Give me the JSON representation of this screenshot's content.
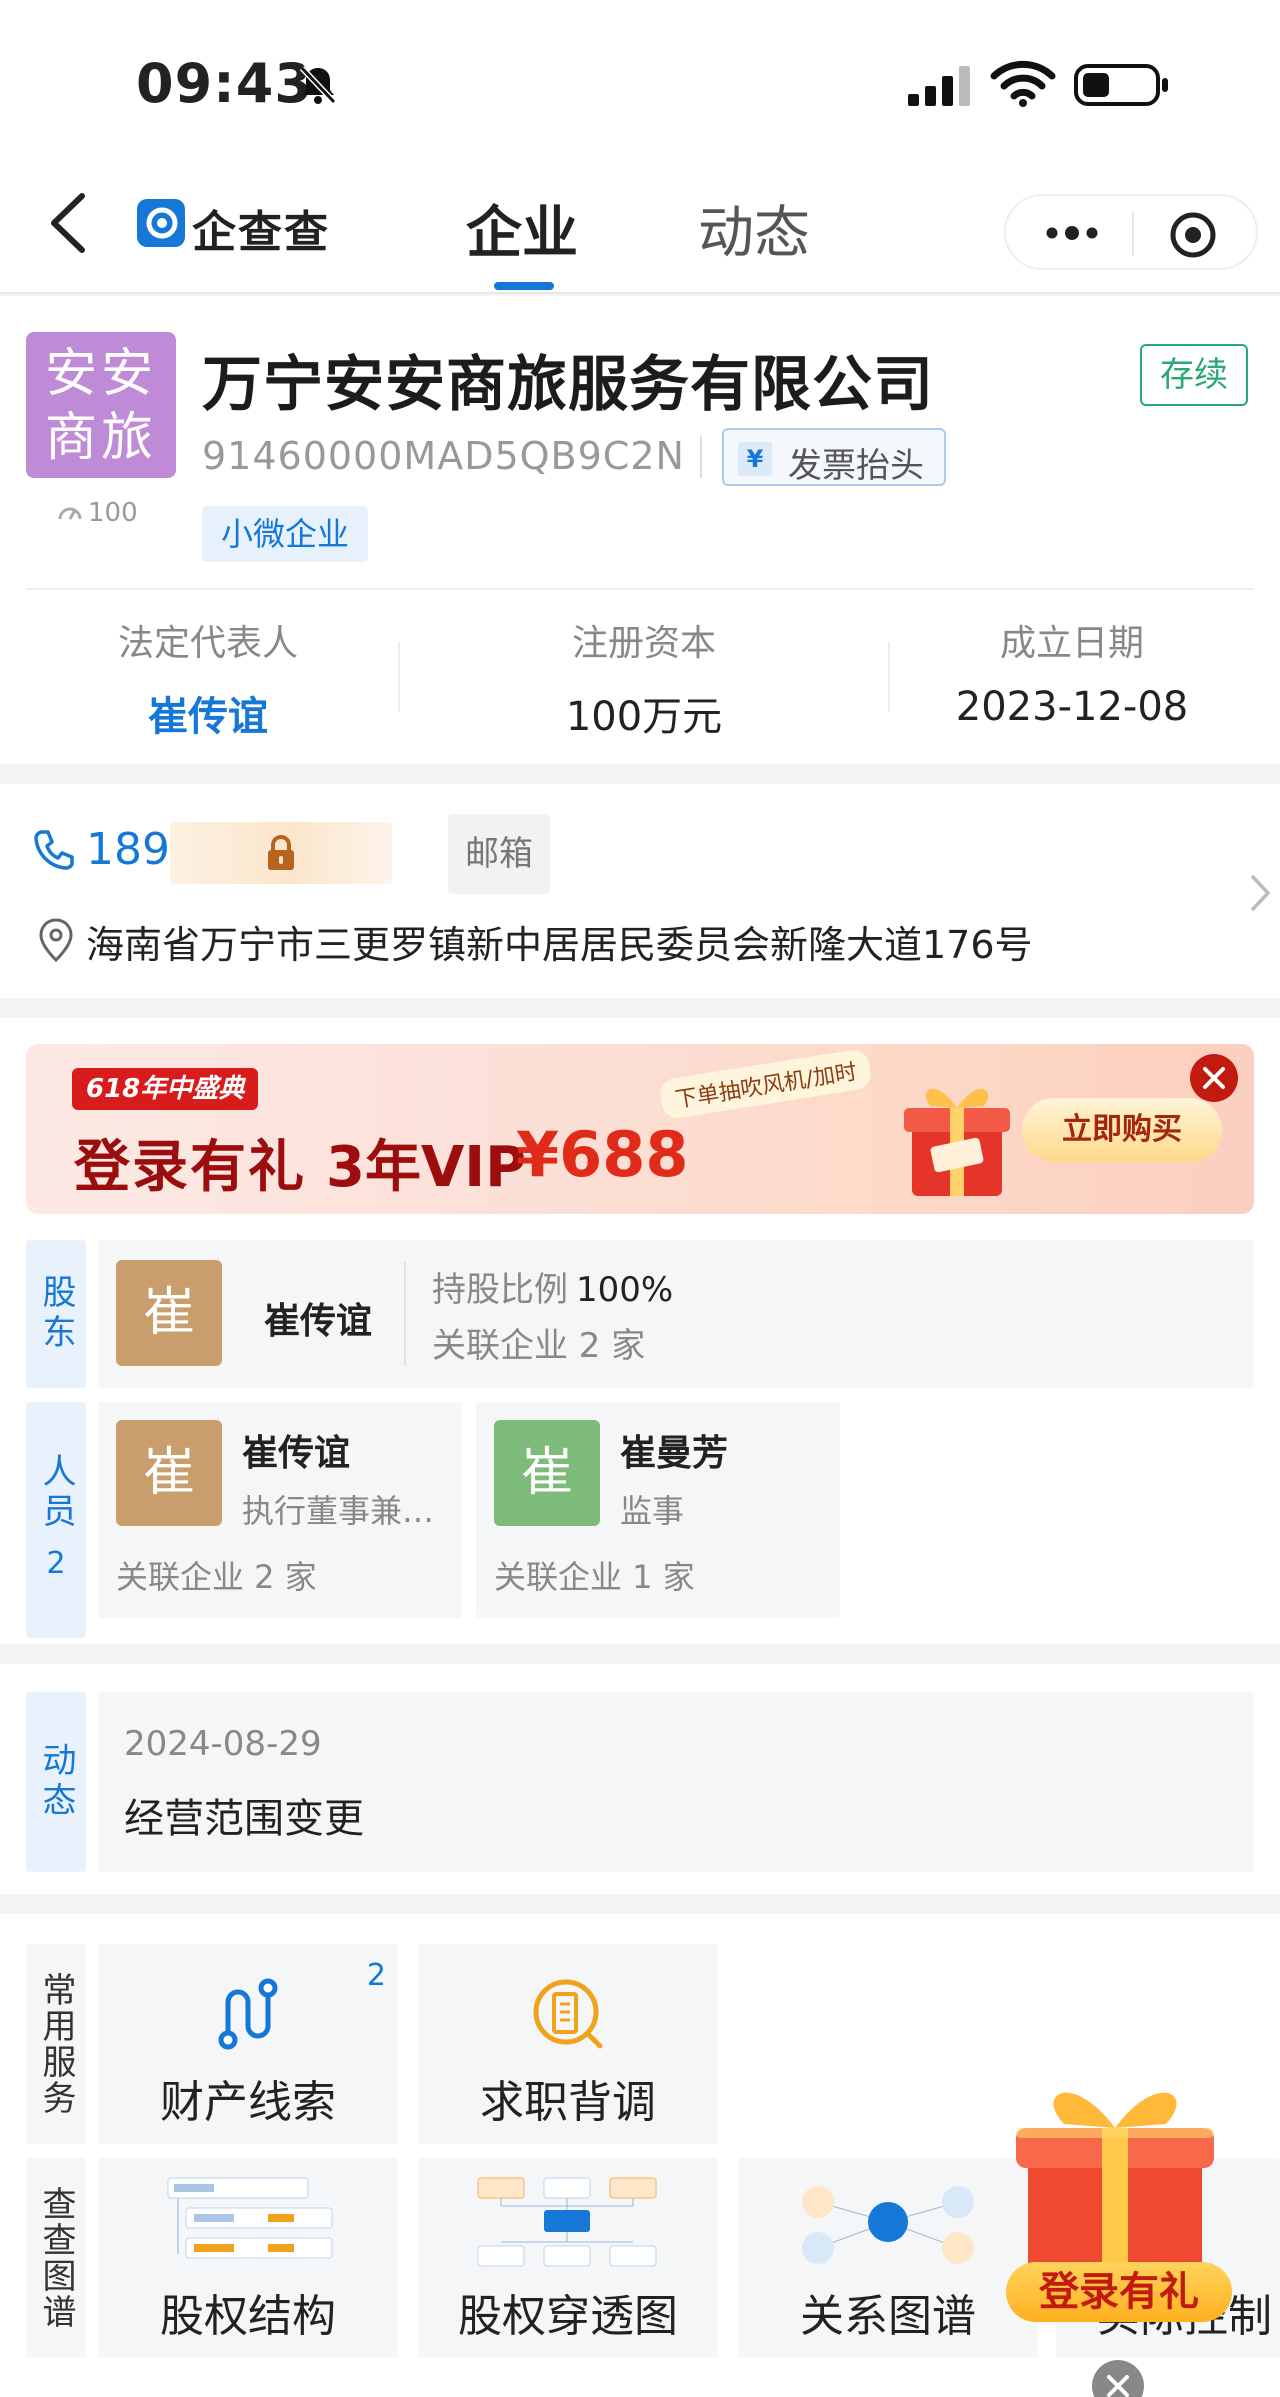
{
  "status_bar": {
    "time": "09:43"
  },
  "nav": {
    "logo": "企查查",
    "tabs": [
      "企业",
      "动态"
    ],
    "active_tab": "企业"
  },
  "company": {
    "avatar_text": "安安商旅",
    "heat": "100",
    "name": "万宁安安商旅服务有限公司",
    "status": "存续",
    "credit_code": "91460000MAD5QB9C2N",
    "invoice_label": "发票抬头",
    "tag": "小微企业",
    "stats": [
      {
        "key": "法定代表人",
        "value": "崔传谊"
      },
      {
        "key": "注册资本",
        "value": "100万元"
      },
      {
        "key": "成立日期",
        "value": "2023-12-08"
      }
    ]
  },
  "contact": {
    "phone_prefix": "189",
    "email_label": "邮箱",
    "address": "海南省万宁市三更罗镇新中居居民委员会新隆大道176号"
  },
  "banner": {
    "chip": "618年中盛典",
    "title": "登录有礼",
    "vip": "3年VIP",
    "price": "¥688",
    "note": "下单抽吹风机/加时",
    "cta": "立即购买"
  },
  "shareholders": {
    "label": "股东",
    "items": [
      {
        "avatar": "崔",
        "name": "崔传谊",
        "ratio_label": "持股比例",
        "ratio": "100%",
        "related": "关联企业 2  家"
      }
    ]
  },
  "staff": {
    "label": "人员",
    "count": "2",
    "items": [
      {
        "avatar": "崔",
        "name": "崔传谊",
        "role": "执行董事兼总经理",
        "related": "关联企业  2  家"
      },
      {
        "avatar": "崔",
        "name": "崔曼芳",
        "role": "监事",
        "related": "关联企业  1  家"
      }
    ]
  },
  "news": {
    "label": "动态",
    "date": "2024-08-29",
    "text": "经营范围变更"
  },
  "services": {
    "label": "常用服务",
    "items": [
      {
        "label": "财产线索",
        "badge": "2",
        "icon": "route-icon"
      },
      {
        "label": "求职背调",
        "icon": "building-search-icon"
      }
    ]
  },
  "graphs": {
    "label": "查查图谱",
    "items": [
      "股权结构",
      "股权穿透图",
      "关系图谱",
      "实际控制"
    ]
  },
  "float_promo": {
    "label": "登录有礼"
  },
  "colors": {
    "accent": "#1578d6",
    "status_green": "#2aa874",
    "brand_purple": "#c08bd6"
  }
}
